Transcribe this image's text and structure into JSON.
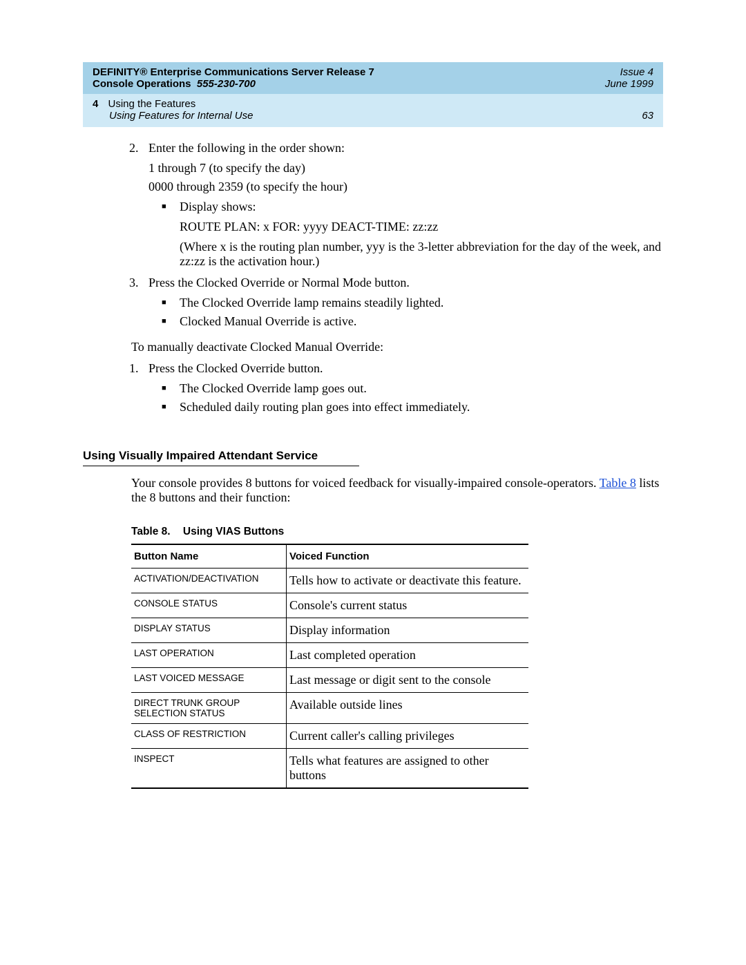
{
  "header": {
    "title_line1": "DEFINITY® Enterprise Communications Server Release 7",
    "title_line2a": "Console Operations",
    "title_line2b": "555-230-700",
    "issue": "Issue 4",
    "date": "June 1999",
    "chapter_num": "4",
    "chapter_title": "Using the Features",
    "subsection": "Using Features for Internal Use",
    "page_num": "63"
  },
  "steps2": {
    "marker": "2.",
    "lead": "Enter the following in the order shown:",
    "line_a": "1 through 7 (to specify the day)",
    "line_b": "0000 through 2359 (to specify the hour)",
    "bullet1": "Display shows:",
    "route_plan": "ROUTE PLAN: x FOR: yyyy DEACT-TIME: zz:zz",
    "explain": "(Where x is the routing plan number, yyy is the 3-letter abbreviation for the day of the week, and zz:zz is the activation hour.)"
  },
  "steps3": {
    "marker": "3.",
    "lead": "Press the Clocked Override or Normal Mode button.",
    "b1": "The Clocked Override lamp remains steadily lighted.",
    "b2": "Clocked Manual Override is active."
  },
  "deact": {
    "intro": "To manually deactivate Clocked Manual Override:",
    "s1_marker": "1.",
    "s1": "Press the Clocked Override button.",
    "b1": "The Clocked Override lamp goes out.",
    "b2": "Scheduled daily routing plan goes into effect immediately."
  },
  "section": {
    "heading": "Using Visually Impaired Attendant Service",
    "para_a": "Your console provides 8 buttons for voiced feedback for visually-impaired console-operators. ",
    "link": "Table 8",
    "para_b": " lists the 8 buttons and their function:"
  },
  "table": {
    "caption_num": "Table 8.",
    "caption_title": "Using VIAS Buttons",
    "col1": "Button Name",
    "col2": "Voiced Function",
    "rows": [
      {
        "name": "ACTIVATION/DEACTIVATION",
        "func": "Tells how to activate or deactivate this feature."
      },
      {
        "name": "CONSOLE STATUS",
        "func": "Console's current status"
      },
      {
        "name": "DISPLAY STATUS",
        "func": "Display information"
      },
      {
        "name": "LAST OPERATION",
        "func": "Last completed operation"
      },
      {
        "name": "LAST VOICED MESSAGE",
        "func": "Last message or digit sent to the console"
      },
      {
        "name": "DIRECT TRUNK GROUP SELECTION STATUS",
        "func": "Available outside lines"
      },
      {
        "name": "CLASS OF RESTRICTION",
        "func": "Current caller's calling privileges"
      },
      {
        "name": "INSPECT",
        "func": "Tells what features are assigned to other buttons"
      }
    ]
  }
}
